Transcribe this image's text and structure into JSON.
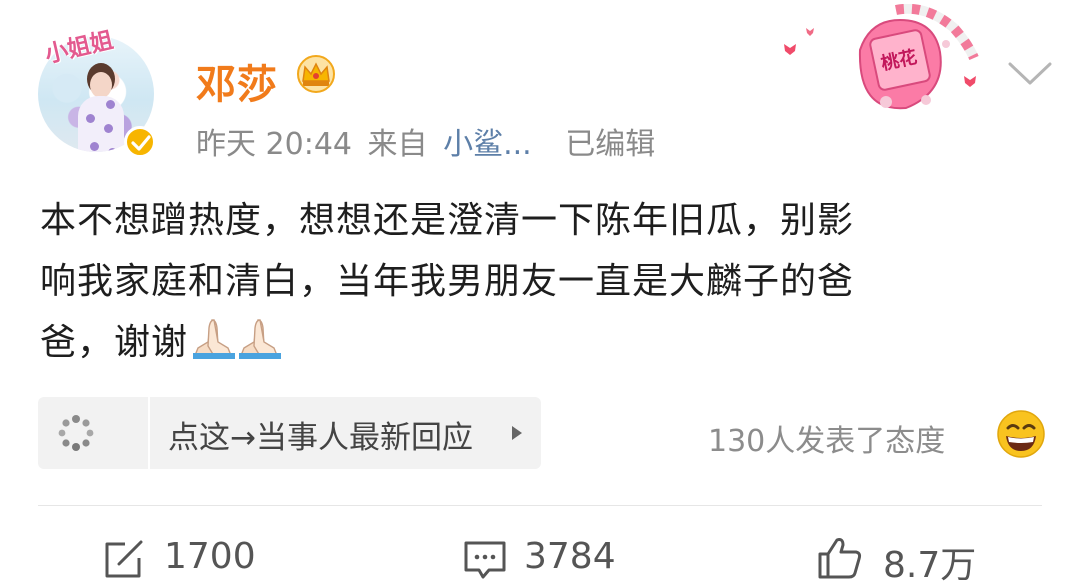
{
  "post": {
    "avatar_text": "小姐姐",
    "author_name": "邓莎",
    "time": "昨天 20:44",
    "source_prefix": "来自",
    "source_name": "小鲨...",
    "edited": "已编辑",
    "sticker_text": "桃花",
    "body_line1": "本不想蹭热度，想想还是澄清一下陈年旧瓜，别影",
    "body_line2": "响我家庭和清白，当年我男朋友一直是大麟子的爸",
    "body_line3": "爸，谢谢"
  },
  "reply": {
    "label": "点这→当事人最新回应"
  },
  "attitude": {
    "text": "130人发表了态度"
  },
  "actions": {
    "repost_count": "1700",
    "comment_count": "3784",
    "like_count": "8.7万"
  },
  "colors": {
    "author": "#f17b1b",
    "source": "#5d7fa8",
    "meta": "#8a8a8a",
    "verified": "#f7b500"
  }
}
